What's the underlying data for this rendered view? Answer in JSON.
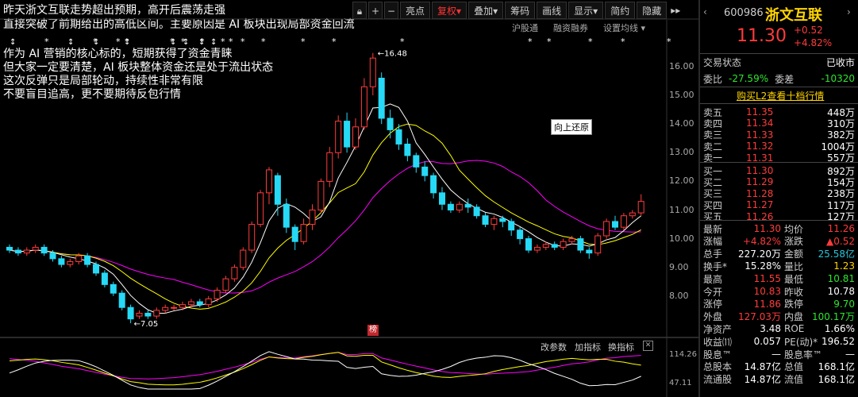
{
  "toolbar": {
    "icons": [
      "lock-icon",
      "plus-icon",
      "minus-icon"
    ],
    "buttons": [
      "亮点",
      "复权",
      "叠加",
      "筹码",
      "画线",
      "显示",
      "简约",
      "隐藏"
    ],
    "active": "复权",
    "sub": [
      "沪股通",
      "融资融券",
      "设置均线"
    ]
  },
  "headline": {
    "line1": "昨天浙文互联走势超出预期，高开后震荡走强",
    "line2": "直接突破了前期给出的高低区间。主要原因是 AI 板块出现局部资金回流"
  },
  "note": [
    "作为 AI 营销的核心标的，短期获得了资金青睐",
    "但大家一定要清楚，AI 板块整体资金还是处于流出状态",
    "这次反弹只是局部轮动，持续性非常有限",
    "不要盲目追高，更不要期待反包行情"
  ],
  "chart": {
    "price_axis": [
      "16.00",
      "15.00",
      "14.00",
      "13.00",
      "12.00",
      "11.00",
      "10.00",
      "9.00",
      "8.00"
    ],
    "high_label": "16.48",
    "low_label": "7.05",
    "tooltip": "向上还原",
    "badge": "榜",
    "sub_tabs": [
      "改参数",
      "加指标",
      "换指标"
    ],
    "sub_axis": [
      "114.26",
      "47.11"
    ],
    "colors": {
      "up": "#ff3b3b",
      "down": "#26d9f5",
      "ma5": "#ffffff",
      "ma10": "#ffff00",
      "ma20": "#ff00ff"
    }
  },
  "chart_data": {
    "type": "candlestick",
    "ylim": [
      7,
      16.5
    ],
    "candles": [
      [
        9.7,
        9.6,
        9.8,
        9.5
      ],
      [
        9.6,
        9.5,
        9.7,
        9.4
      ],
      [
        9.5,
        9.6,
        9.7,
        9.4
      ],
      [
        9.6,
        9.7,
        9.8,
        9.5
      ],
      [
        9.7,
        9.5,
        9.8,
        9.4
      ],
      [
        9.5,
        9.3,
        9.6,
        9.2
      ],
      [
        9.3,
        9.1,
        9.4,
        9.0
      ],
      [
        9.1,
        9.2,
        9.3,
        9.0
      ],
      [
        9.2,
        9.4,
        9.5,
        9.1
      ],
      [
        9.4,
        9.1,
        9.5,
        9.0
      ],
      [
        9.1,
        8.8,
        9.2,
        8.7
      ],
      [
        8.8,
        8.4,
        8.9,
        8.3
      ],
      [
        8.4,
        8.1,
        8.5,
        8.0
      ],
      [
        8.1,
        7.6,
        8.2,
        7.5
      ],
      [
        7.6,
        7.2,
        7.7,
        7.05
      ],
      [
        7.3,
        7.4,
        7.5,
        7.2
      ],
      [
        7.4,
        7.3,
        7.5,
        7.2
      ],
      [
        7.3,
        7.5,
        7.6,
        7.2
      ],
      [
        7.5,
        7.6,
        7.7,
        7.4
      ],
      [
        7.6,
        7.6,
        7.7,
        7.5
      ],
      [
        7.6,
        7.7,
        7.8,
        7.5
      ],
      [
        7.7,
        7.8,
        7.9,
        7.6
      ],
      [
        7.8,
        7.7,
        7.9,
        7.6
      ],
      [
        7.7,
        7.9,
        8.0,
        7.6
      ],
      [
        7.9,
        8.2,
        8.3,
        7.8
      ],
      [
        8.2,
        8.6,
        8.7,
        8.1
      ],
      [
        8.6,
        9.0,
        9.1,
        8.5
      ],
      [
        9.0,
        9.6,
        9.7,
        8.9
      ],
      [
        9.6,
        10.5,
        10.6,
        9.5
      ],
      [
        10.5,
        11.6,
        11.7,
        10.4
      ],
      [
        11.6,
        12.4,
        12.5,
        11.2
      ],
      [
        12.2,
        11.2,
        12.3,
        10.8
      ],
      [
        11.2,
        10.4,
        11.4,
        10.2
      ],
      [
        10.4,
        9.9,
        10.5,
        9.6
      ],
      [
        9.9,
        10.5,
        10.7,
        9.8
      ],
      [
        10.5,
        11.0,
        11.2,
        10.3
      ],
      [
        11.0,
        12.0,
        12.1,
        10.9
      ],
      [
        12.0,
        13.0,
        13.2,
        11.8
      ],
      [
        13.0,
        14.1,
        14.3,
        12.8
      ],
      [
        14.1,
        13.2,
        14.4,
        13.0
      ],
      [
        13.2,
        13.9,
        14.2,
        13.1
      ],
      [
        13.9,
        15.3,
        15.6,
        13.8
      ],
      [
        15.3,
        16.3,
        16.48,
        15.0
      ],
      [
        15.6,
        14.2,
        15.8,
        14.0
      ],
      [
        14.2,
        13.8,
        14.5,
        13.5
      ],
      [
        13.8,
        13.3,
        14.0,
        13.1
      ],
      [
        13.3,
        12.9,
        13.5,
        12.7
      ],
      [
        12.9,
        12.5,
        13.0,
        12.3
      ],
      [
        12.5,
        12.2,
        12.7,
        12.0
      ],
      [
        12.2,
        11.6,
        12.3,
        11.4
      ],
      [
        11.6,
        11.2,
        11.8,
        11.0
      ],
      [
        11.2,
        11.0,
        11.3,
        10.9
      ],
      [
        11.0,
        11.2,
        11.3,
        10.9
      ],
      [
        11.2,
        11.1,
        11.4,
        10.9
      ],
      [
        11.1,
        10.8,
        11.2,
        10.7
      ],
      [
        10.8,
        10.5,
        10.9,
        10.4
      ],
      [
        10.5,
        10.7,
        10.8,
        10.3
      ],
      [
        10.7,
        10.6,
        10.8,
        10.4
      ],
      [
        10.6,
        10.3,
        10.7,
        10.1
      ],
      [
        10.3,
        10.0,
        10.4,
        9.8
      ],
      [
        10.0,
        9.6,
        10.1,
        9.5
      ],
      [
        9.6,
        9.7,
        9.8,
        9.5
      ],
      [
        9.7,
        9.8,
        9.9,
        9.6
      ],
      [
        9.8,
        9.7,
        9.9,
        9.6
      ],
      [
        9.7,
        9.9,
        10.0,
        9.6
      ],
      [
        9.9,
        10.0,
        10.1,
        9.8
      ],
      [
        10.0,
        9.6,
        10.1,
        9.5
      ],
      [
        9.6,
        9.5,
        9.7,
        9.3
      ],
      [
        9.5,
        10.1,
        10.2,
        9.4
      ],
      [
        10.1,
        10.6,
        10.7,
        10.0
      ],
      [
        10.6,
        10.4,
        10.8,
        10.3
      ],
      [
        10.4,
        10.8,
        10.9,
        10.3
      ],
      [
        10.8,
        10.9,
        11.0,
        10.7
      ],
      [
        10.9,
        11.3,
        11.55,
        10.81
      ]
    ],
    "sub_values": [
      "114.26",
      "47.11"
    ]
  },
  "quote": {
    "code": "600986",
    "name": "浙文互联",
    "price": "11.30",
    "change": "+0.52",
    "pct": "+4.82%",
    "status_label": "交易状态",
    "status": "已收市",
    "weibi_label": "委比",
    "weibi": "-27.59%",
    "weicha_label": "委差",
    "weicha": "-10320",
    "l2": "购买L2查看十档行情",
    "asks": [
      {
        "label": "卖五",
        "price": "11.35",
        "vol": "448万"
      },
      {
        "label": "卖四",
        "price": "11.34",
        "vol": "310万"
      },
      {
        "label": "卖三",
        "price": "11.33",
        "vol": "382万"
      },
      {
        "label": "卖二",
        "price": "11.32",
        "vol": "1004万"
      },
      {
        "label": "卖一",
        "price": "11.31",
        "vol": "557万"
      }
    ],
    "bids": [
      {
        "label": "买一",
        "price": "11.30",
        "vol": "892万"
      },
      {
        "label": "买二",
        "price": "11.29",
        "vol": "154万"
      },
      {
        "label": "买三",
        "price": "11.28",
        "vol": "238万"
      },
      {
        "label": "买四",
        "price": "11.27",
        "vol": "117万"
      },
      {
        "label": "买五",
        "price": "11.26",
        "vol": "127万"
      }
    ],
    "stats": [
      {
        "l1": "最新",
        "v1": "11.30",
        "c1": "red",
        "l2": "均价",
        "v2": "11.26",
        "c2": "red"
      },
      {
        "l1": "涨幅",
        "v1": "+4.82%",
        "c1": "red",
        "l2": "涨跌",
        "v2": "▲0.52",
        "c2": "red"
      },
      {
        "l1": "总手",
        "v1": "227.20万",
        "c1": "wht",
        "l2": "金额",
        "v2": "25.58亿",
        "c2": "cyan"
      },
      {
        "l1": "换手*",
        "v1": "15.28%",
        "c1": "wht",
        "l2": "量比",
        "v2": "1.23",
        "c2": "yel"
      },
      {
        "l1": "最高",
        "v1": "11.55",
        "c1": "red",
        "l2": "最低",
        "v2": "10.81",
        "c2": "green"
      },
      {
        "l1": "今开",
        "v1": "10.83",
        "c1": "red",
        "l2": "昨收",
        "v2": "10.78",
        "c2": "wht"
      },
      {
        "l1": "涨停",
        "v1": "11.86",
        "c1": "red",
        "l2": "跌停",
        "v2": "9.70",
        "c2": "green"
      },
      {
        "l1": "外盘",
        "v1": "127.03万",
        "c1": "red",
        "l2": "内盘",
        "v2": "100.17万",
        "c2": "green"
      },
      {
        "l1": "净资产",
        "v1": "3.48",
        "c1": "wht",
        "l2": "ROE",
        "v2": "1.66%",
        "c2": "wht"
      },
      {
        "l1": "收益⑾",
        "v1": "0.057",
        "c1": "wht",
        "l2": "PE(动)*",
        "v2": "196.52",
        "c2": "wht"
      },
      {
        "l1": "股息™",
        "v1": "—",
        "c1": "wht",
        "l2": "股息率™",
        "v2": "—",
        "c2": "wht"
      },
      {
        "l1": "总股本",
        "v1": "14.87亿",
        "c1": "wht",
        "l2": "总值",
        "v2": "168.1亿",
        "c2": "wht"
      },
      {
        "l1": "流通股",
        "v1": "14.87亿",
        "c1": "wht",
        "l2": "流值",
        "v2": "168.1亿",
        "c2": "wht"
      }
    ]
  }
}
